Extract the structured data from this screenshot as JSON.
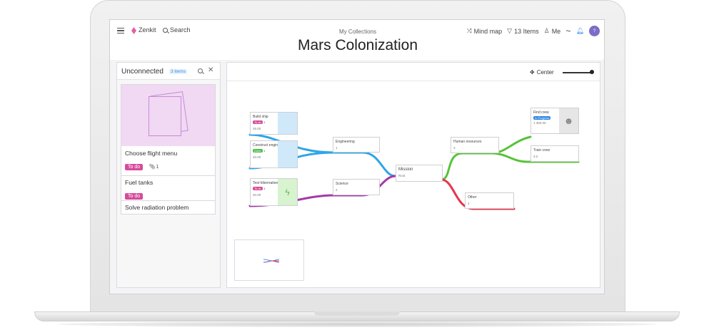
{
  "topbar": {
    "menu_icon": "hamburger-icon",
    "brand": "Zenkit",
    "search_label": "Search",
    "breadcrumb": "My Collections",
    "title": "Mars Colonization",
    "view_label": "Mind map",
    "filter_label": "13 Items",
    "user_label": "Me",
    "avatar_initials": "?"
  },
  "unconnected": {
    "title": "Unconnected",
    "count_label": "3 items",
    "cards": [
      {
        "title": "Choose flight menu",
        "tag": "To do",
        "attachments": "1"
      },
      {
        "title": "Fuel tanks",
        "tag": "To do"
      },
      {
        "title": "Solve radiation problem"
      }
    ]
  },
  "map": {
    "center_label": "Center",
    "nodes": {
      "build_ship": {
        "name": "Build ship",
        "tag": "To do",
        "count": "1",
        "value": "35.00"
      },
      "construct_engines": {
        "name": "Construct engines",
        "tag": "Done",
        "count": "1",
        "value": "40.00"
      },
      "test_hibernation": {
        "name": "Test hibernation",
        "tag": "To do",
        "count": "1",
        "value": "20.00"
      },
      "engineering": {
        "name": "Engineering",
        "value": "1"
      },
      "science": {
        "name": "Science",
        "value": "2"
      },
      "mission": {
        "name": "Mission",
        "value": "Root"
      },
      "human_resources": {
        "name": "Human resources",
        "value": "3"
      },
      "other": {
        "name": "Other",
        "value": "4"
      },
      "find_crew": {
        "name": "Find crew",
        "tag": "In Progress",
        "count": "1",
        "value": "350.00"
      },
      "train_crew": {
        "name": "Train crew",
        "value": "3.2"
      }
    }
  },
  "colors": {
    "blue": "#2ea6e6",
    "purple": "#a33aa8",
    "green": "#59c23a",
    "red": "#e8344a",
    "todo": "#d64a9c",
    "done": "#4cbf4a",
    "progress": "#2f86de"
  }
}
